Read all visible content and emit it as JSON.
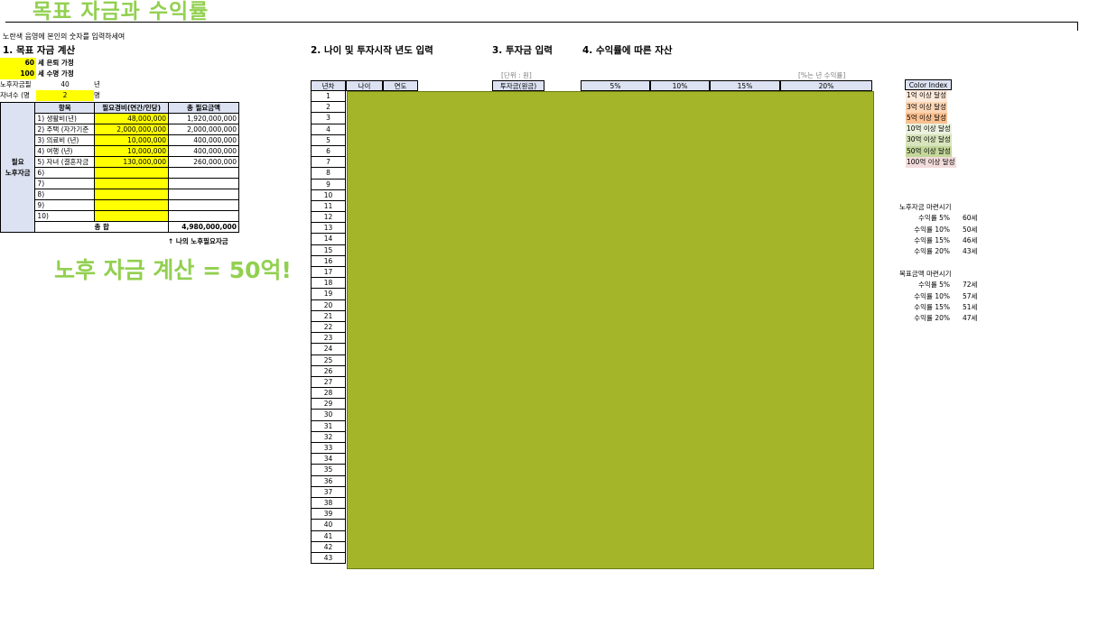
{
  "title": "목표 자금과 수익률",
  "instruction": "노란색 음영에 본인의 숫자를 입력하세여",
  "sections": {
    "s1": "1. 목표 자금 계산",
    "s2": "2. 나이 및 투자시작 년도 입력",
    "s3": "3. 투자금 입력",
    "s4": "4. 수익률에 따른 자산"
  },
  "assumptions": {
    "retire_age": "60",
    "retire_label": "세 은퇴 가정",
    "life_age": "100",
    "life_label": "세 수명 가정",
    "years_label": "노후자금필",
    "years_value": "40",
    "years_unit": "년",
    "kids_label": "자녀수 (명",
    "kids_value": "2",
    "kids_unit": "명"
  },
  "expense_table": {
    "side_label_1": "필요",
    "side_label_2": "노후자금",
    "headers": [
      "항목",
      "필요경비(연간/인당)",
      "총 필요금액"
    ],
    "rows": [
      {
        "item": "1) 생활비(년)",
        "cost": "48,000,000",
        "total": "1,920,000,000"
      },
      {
        "item": "2) 주택 (자가기준",
        "cost": "2,000,000,000",
        "total": "2,000,000,000"
      },
      {
        "item": "3) 의료비 (년)",
        "cost": "10,000,000",
        "total": "400,000,000"
      },
      {
        "item": "4) 여행 (년)",
        "cost": "10,000,000",
        "total": "400,000,000"
      },
      {
        "item": "5) 자녀 (결혼자금",
        "cost": "130,000,000",
        "total": "260,000,000"
      },
      {
        "item": "6)",
        "cost": "",
        "total": ""
      },
      {
        "item": "7)",
        "cost": "",
        "total": ""
      },
      {
        "item": "8)",
        "cost": "",
        "total": ""
      },
      {
        "item": "9)",
        "cost": "",
        "total": ""
      },
      {
        "item": "10)",
        "cost": "",
        "total": ""
      }
    ],
    "sum_label": "총 합",
    "sum_value": "4,980,000,000",
    "footnote": "↑ 나의 노후필요자금"
  },
  "big_note": "노후 자금 계산 = 50억!",
  "grid": {
    "unit_note": "[단위 : 원]",
    "rate_note": "[%는 년 수익률]",
    "headers": [
      "년차",
      "나이",
      "연도",
      "투자금(원금)",
      "5%",
      "10%",
      "15%",
      "20%"
    ],
    "rows": [
      "1",
      "2",
      "3",
      "4",
      "5",
      "6",
      "7",
      "8",
      "9",
      "10",
      "11",
      "12",
      "13",
      "14",
      "15",
      "16",
      "17",
      "18",
      "19",
      "20",
      "21",
      "22",
      "23",
      "24",
      "25",
      "26",
      "27",
      "28",
      "29",
      "30",
      "31",
      "32",
      "33",
      "34",
      "35",
      "36",
      "37",
      "38",
      "39",
      "40",
      "41",
      "42",
      "43"
    ],
    "fill_color": "#a5b529"
  },
  "color_index": {
    "title": "Color Index",
    "items": [
      {
        "label": "1억 이상 달성",
        "color": "#fde9d9"
      },
      {
        "label": "3억 이상 달성",
        "color": "#fcd5b4"
      },
      {
        "label": "5억 이상 달성",
        "color": "#fac090"
      },
      {
        "label": "10억 이상 달성",
        "color": "#ebf1de"
      },
      {
        "label": "30억 이상 달성",
        "color": "#d8e4bc"
      },
      {
        "label": "50억 이상 달성",
        "color": "#c4d79b"
      },
      {
        "label": "100억 이상 달성",
        "color": "#f2dcdb"
      }
    ]
  },
  "retire_fund": {
    "title": "노후자금 마련시기",
    "items": [
      {
        "label": "수익률 5%",
        "age": "60세"
      },
      {
        "label": "수익률 10%",
        "age": "50세"
      },
      {
        "label": "수익률 15%",
        "age": "46세"
      },
      {
        "label": "수익률 20%",
        "age": "43세"
      }
    ]
  },
  "target_fund": {
    "title": "목표금액 마련시기",
    "items": [
      {
        "label": "수익률 5%",
        "age": "72세"
      },
      {
        "label": "수익률 10%",
        "age": "57세"
      },
      {
        "label": "수익률 15%",
        "age": "51세"
      },
      {
        "label": "수익률 20%",
        "age": "47세"
      }
    ]
  }
}
